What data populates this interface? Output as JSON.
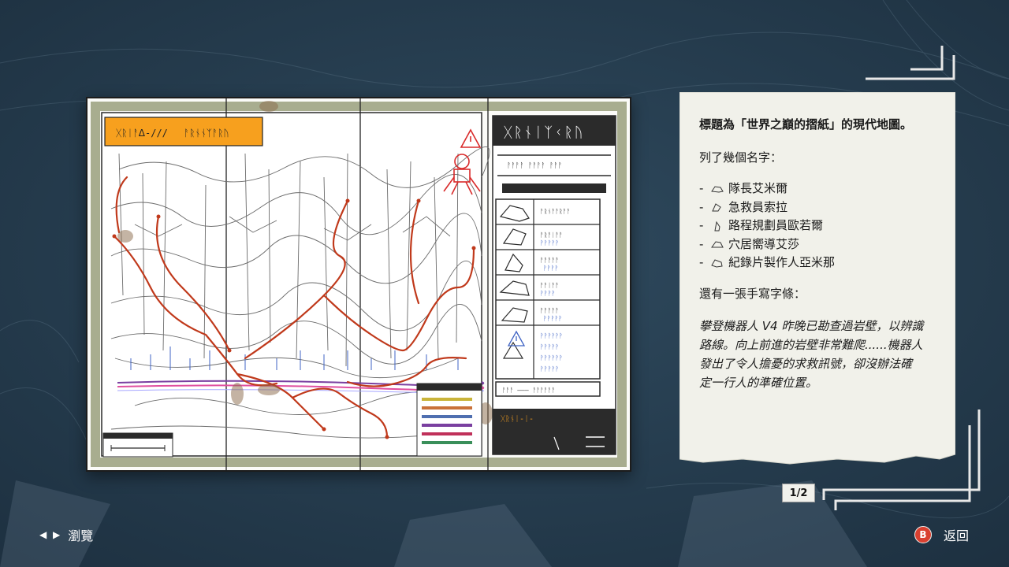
{
  "card": {
    "title": "標題為「世界之巔的摺紙」的現代地圖。",
    "names_intro": "列了幾個名字：",
    "names": [
      {
        "dash": "-",
        "icon": "bear-icon",
        "label": "隊長艾米爾"
      },
      {
        "dash": "-",
        "icon": "bird-icon",
        "label": "急救員索拉"
      },
      {
        "dash": "-",
        "icon": "penguin-icon",
        "label": "路程規劃員歐若爾"
      },
      {
        "dash": "-",
        "icon": "goat-icon",
        "label": "穴居嚮導艾莎"
      },
      {
        "dash": "-",
        "icon": "dog-icon",
        "label": "紀錄片製作人亞米那"
      }
    ],
    "note_intro": "還有一張手寫字條：",
    "note_lines": [
      "攀登機器人 V4 昨晚已勘查過岩壁，以辨識",
      "路線。向上前進的岩壁非常難爬......機器人",
      "發出了令人擔憂的求救訊號，卻沒辦法確",
      "定一行人的準確位置。"
    ]
  },
  "pagination": {
    "current_label": "1/2"
  },
  "hints": {
    "browse_arrows": "◀ ▶",
    "browse_label": "瀏覽",
    "back_button_glyph": "B",
    "back_label": "返回"
  },
  "colors": {
    "map_olive": "#a8ad8f",
    "title_orange": "#f7a01e",
    "route_red": "#c0391b",
    "ink_dark": "#2b2b2b",
    "card_paper": "#f1f1ea",
    "back_button": "#d94030"
  },
  "map": {
    "legend_bar_colors": [
      "#c9b43a",
      "#c9713a",
      "#4f6fb0",
      "#7a3fa0",
      "#c0305a",
      "#3a8f5a"
    ]
  }
}
